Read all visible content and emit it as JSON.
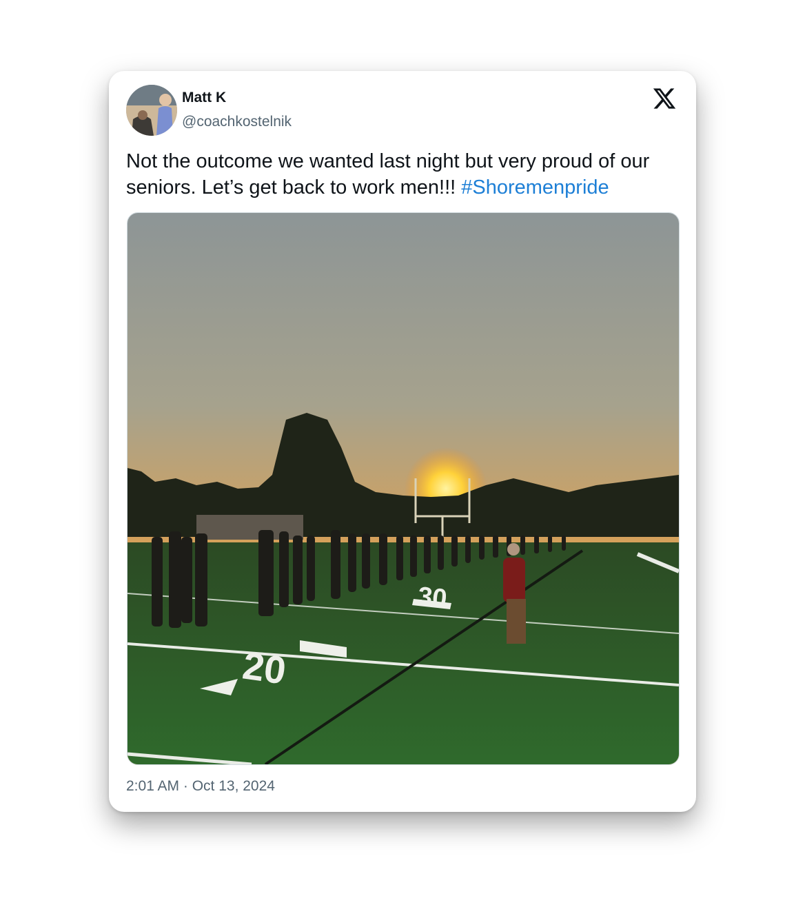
{
  "tweet": {
    "author_name": "Matt K",
    "author_handle": "@coachkostelnik",
    "text": "Not the outcome we wanted last night but very proud of our seniors. Let’s get back to work men!!! ",
    "hashtag": "#Shoremenpride",
    "timestamp": "2:01 AM · Oct 13, 2024"
  },
  "icons": {
    "platform": "x-logo-icon",
    "avatar": "avatar"
  },
  "colors": {
    "link": "#1d7fd6",
    "text": "#0f1419",
    "muted": "#536471"
  },
  "photo": {
    "markings": [
      "20",
      "30"
    ]
  }
}
